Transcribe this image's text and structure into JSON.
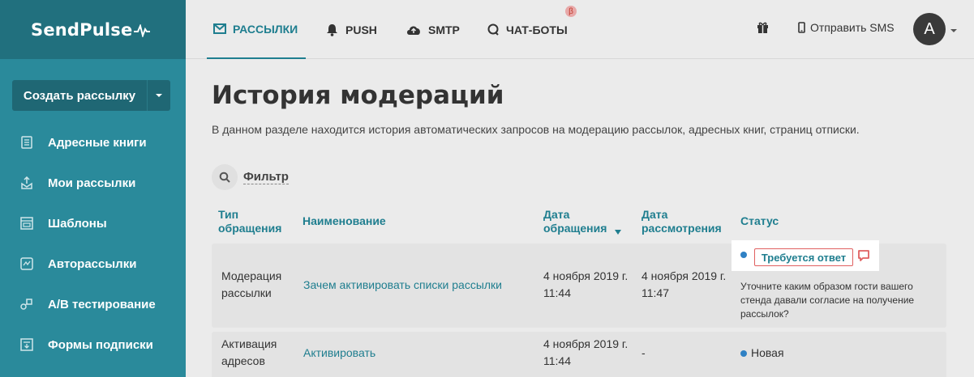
{
  "brand": {
    "name": "SendPulse"
  },
  "sidebar": {
    "create_label": "Создать рассылку",
    "items": [
      {
        "label": "Адресные книги",
        "icon": "address-book-icon"
      },
      {
        "label": "Мои рассылки",
        "icon": "campaigns-icon"
      },
      {
        "label": "Шаблоны",
        "icon": "templates-icon"
      },
      {
        "label": "Авторассылки",
        "icon": "automation-icon"
      },
      {
        "label": "A/B тестирование",
        "icon": "ab-test-icon"
      },
      {
        "label": "Формы подписки",
        "icon": "forms-icon"
      }
    ]
  },
  "topnav": {
    "tabs": [
      {
        "label": "РАССЫЛКИ",
        "icon": "mail-icon"
      },
      {
        "label": "PUSH",
        "icon": "bell-icon"
      },
      {
        "label": "SMTP",
        "icon": "cloud-icon"
      },
      {
        "label": "ЧАТ-БОТЫ",
        "icon": "chat-icon"
      }
    ],
    "beta_badge": "β",
    "sms_label": "Отправить SMS",
    "avatar_letter": "A"
  },
  "page": {
    "title": "История модераций",
    "description": "В данном разделе находится история автоматических запросов на модерацию рассылок, адресных книг, страниц отписки.",
    "filter_label": "Фильтр"
  },
  "table": {
    "headers": {
      "type": "Тип обращения",
      "name": "Наименование",
      "date": "Дата обращения",
      "review": "Дата рассмотрения",
      "status": "Статус"
    },
    "rows": [
      {
        "type": "Модерация рассылки",
        "name": "Зачем активировать списки рассылки",
        "date": "4 ноября 2019 г. 11:44",
        "review": "4 ноября 2019 г. 11:47",
        "status": "Требуется ответ",
        "note": "Уточните каким образом гости вашего стенда давали согласие на получение рассылок?"
      },
      {
        "type": "Активация адресов",
        "name": "Активировать",
        "date": "4 ноября 2019 г. 11:44",
        "review": "-",
        "status": "Новая"
      }
    ]
  },
  "colors": {
    "accent": "#1f7e8f",
    "sidebar": "#2a8a9b",
    "status_dot": "#2f81c4",
    "alert": "#e06060"
  }
}
